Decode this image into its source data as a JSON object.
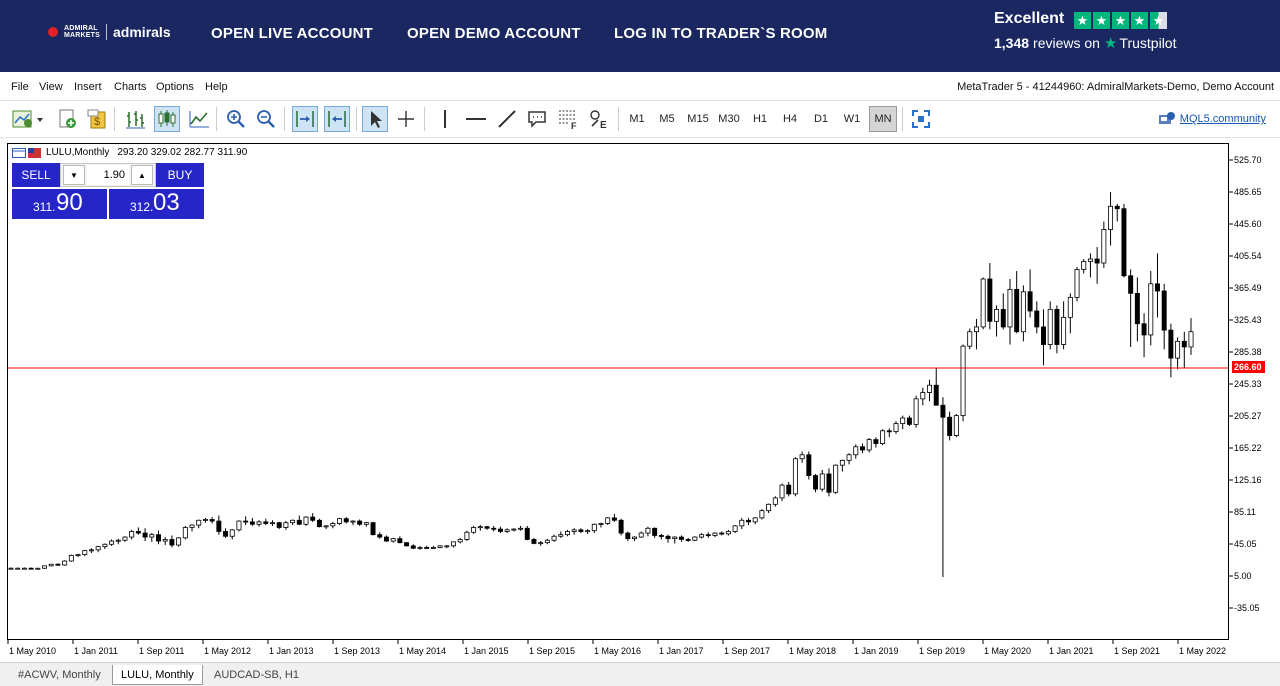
{
  "banner": {
    "logo_small_1": "ADMIRAL",
    "logo_small_2": "MARKETS",
    "logo_name": "admirals",
    "links": [
      "OPEN LIVE ACCOUNT",
      "OPEN DEMO ACCOUNT",
      "LOG IN TO TRADER`S ROOM"
    ],
    "trustpilot": {
      "rating_label": "Excellent",
      "review_count": "1,348",
      "reviews_word": "reviews on",
      "brand": "Trustpilot",
      "stars": 4.5
    }
  },
  "menu": {
    "items": [
      "File",
      "View",
      "Insert",
      "Charts",
      "Options",
      "Help"
    ],
    "window_title": "MetaTrader 5 - 41244960: AdmiralMarkets-Demo, Demo Account"
  },
  "toolbar": {
    "timeframes": [
      "M1",
      "M5",
      "M15",
      "M30",
      "H1",
      "H4",
      "D1",
      "W1",
      "MN"
    ],
    "active_timeframe": "MN",
    "community_link": "MQL5.community"
  },
  "chart": {
    "symbol_label": "LULU,Monthly",
    "ohlc_text": "293.20 329.02 282.77 311.90",
    "current_price_label": "266.60",
    "colors": {
      "price_line": "#ff0000",
      "candle": "#000000",
      "trade_blue": "#2626c8",
      "banner": "#1a2760"
    }
  },
  "trade_panel": {
    "sell_label": "SELL",
    "buy_label": "BUY",
    "lot": "1.90",
    "sell_price_small": "311.",
    "sell_price_big": "90",
    "buy_price_small": "312.",
    "buy_price_big": "03"
  },
  "chart_data": {
    "type": "candlestick",
    "title": "",
    "price_ticks": [
      "525.70",
      "485.65",
      "445.60",
      "405.54",
      "365.49",
      "325.43",
      "285.38",
      "245.33",
      "205.27",
      "165.22",
      "125.16",
      "85.11",
      "45.05",
      "5.00",
      "-35.05"
    ],
    "time_ticks": [
      "1 May 2010",
      "1 Jan 2011",
      "1 Sep 2011",
      "1 May 2012",
      "1 Jan 2013",
      "1 Sep 2013",
      "1 May 2014",
      "1 Jan 2015",
      "1 Sep 2015",
      "1 May 2016",
      "1 Jan 2017",
      "1 Sep 2017",
      "1 May 2018",
      "1 Jan 2019",
      "1 Sep 2019",
      "1 May 2020",
      "1 Jan 2021",
      "1 Sep 2021",
      "1 May 2022"
    ],
    "horizontal_line": 266.6,
    "ohlc": [
      [
        15,
        17,
        14,
        16
      ],
      [
        16,
        17,
        15,
        16
      ],
      [
        16,
        17,
        15,
        16
      ],
      [
        16,
        17,
        15,
        15
      ],
      [
        15,
        16,
        14,
        16
      ],
      [
        16,
        19,
        15,
        19
      ],
      [
        19,
        21,
        18,
        21
      ],
      [
        21,
        22,
        19,
        20
      ],
      [
        20,
        26,
        19,
        25
      ],
      [
        25,
        33,
        24,
        32
      ],
      [
        32,
        34,
        30,
        33
      ],
      [
        33,
        39,
        31,
        38
      ],
      [
        38,
        41,
        35,
        39
      ],
      [
        39,
        44,
        36,
        43
      ],
      [
        43,
        47,
        40,
        46
      ],
      [
        46,
        52,
        44,
        50
      ],
      [
        50,
        53,
        46,
        51
      ],
      [
        51,
        56,
        49,
        55
      ],
      [
        55,
        64,
        52,
        62
      ],
      [
        62,
        67,
        58,
        60
      ],
      [
        60,
        66,
        50,
        55
      ],
      [
        55,
        60,
        49,
        58
      ],
      [
        58,
        63,
        46,
        50
      ],
      [
        50,
        55,
        45,
        52
      ],
      [
        52,
        57,
        42,
        45
      ],
      [
        45,
        55,
        43,
        54
      ],
      [
        54,
        69,
        52,
        67
      ],
      [
        67,
        71,
        62,
        70
      ],
      [
        70,
        77,
        66,
        76
      ],
      [
        76,
        79,
        73,
        77
      ],
      [
        77,
        80,
        72,
        75
      ],
      [
        75,
        82,
        58,
        62
      ],
      [
        62,
        66,
        54,
        56
      ],
      [
        56,
        65,
        52,
        64
      ],
      [
        64,
        76,
        62,
        75
      ],
      [
        75,
        81,
        70,
        74
      ],
      [
        74,
        79,
        69,
        71
      ],
      [
        71,
        76,
        68,
        74
      ],
      [
        74,
        78,
        70,
        72
      ],
      [
        72,
        76,
        69,
        73
      ],
      [
        73,
        74,
        65,
        67
      ],
      [
        67,
        75,
        64,
        73
      ],
      [
        73,
        77,
        70,
        76
      ],
      [
        76,
        82,
        70,
        71
      ],
      [
        71,
        81,
        69,
        80
      ],
      [
        80,
        85,
        74,
        76
      ],
      [
        76,
        78,
        67,
        68
      ],
      [
        68,
        70,
        65,
        69
      ],
      [
        69,
        74,
        66,
        72
      ],
      [
        72,
        79,
        70,
        78
      ],
      [
        78,
        80,
        72,
        74
      ],
      [
        74,
        76,
        70,
        75
      ],
      [
        75,
        77,
        69,
        71
      ],
      [
        71,
        74,
        68,
        73
      ],
      [
        73,
        74,
        57,
        58
      ],
      [
        58,
        61,
        53,
        55
      ],
      [
        55,
        57,
        49,
        50
      ],
      [
        50,
        54,
        48,
        53
      ],
      [
        53,
        56,
        47,
        48
      ],
      [
        48,
        49,
        43,
        44
      ],
      [
        44,
        46,
        40,
        41
      ],
      [
        41,
        44,
        39,
        42
      ],
      [
        42,
        44,
        40,
        41
      ],
      [
        41,
        44,
        40,
        42
      ],
      [
        42,
        45,
        41,
        44
      ],
      [
        44,
        45,
        41,
        44
      ],
      [
        44,
        49,
        42,
        49
      ],
      [
        49,
        54,
        47,
        52
      ],
      [
        52,
        63,
        50,
        61
      ],
      [
        61,
        69,
        59,
        67
      ],
      [
        67,
        70,
        63,
        68
      ],
      [
        68,
        69,
        64,
        66
      ],
      [
        66,
        69,
        62,
        65
      ],
      [
        65,
        68,
        60,
        62
      ],
      [
        62,
        66,
        60,
        64
      ],
      [
        64,
        66,
        62,
        65
      ],
      [
        65,
        69,
        63,
        66
      ],
      [
        66,
        69,
        51,
        52
      ],
      [
        52,
        54,
        46,
        47
      ],
      [
        47,
        50,
        44,
        48
      ],
      [
        48,
        53,
        46,
        51
      ],
      [
        51,
        58,
        49,
        56
      ],
      [
        56,
        62,
        54,
        58
      ],
      [
        58,
        64,
        56,
        62
      ],
      [
        62,
        66,
        58,
        64
      ],
      [
        64,
        66,
        60,
        62
      ],
      [
        62,
        65,
        59,
        63
      ],
      [
        63,
        72,
        60,
        71
      ],
      [
        71,
        73,
        67,
        72
      ],
      [
        72,
        80,
        70,
        79
      ],
      [
        79,
        84,
        74,
        76
      ],
      [
        76,
        78,
        57,
        60
      ],
      [
        60,
        62,
        50,
        53
      ],
      [
        53,
        56,
        50,
        55
      ],
      [
        55,
        62,
        54,
        60
      ],
      [
        60,
        68,
        56,
        66
      ],
      [
        66,
        67,
        54,
        57
      ],
      [
        57,
        59,
        52,
        56
      ],
      [
        56,
        58,
        48,
        53
      ],
      [
        53,
        56,
        47,
        55
      ],
      [
        55,
        57,
        49,
        52
      ],
      [
        52,
        54,
        49,
        51
      ],
      [
        51,
        56,
        50,
        55
      ],
      [
        55,
        60,
        53,
        58
      ],
      [
        58,
        61,
        54,
        57
      ],
      [
        57,
        61,
        55,
        60
      ],
      [
        60,
        62,
        57,
        59
      ],
      [
        59,
        64,
        57,
        62
      ],
      [
        62,
        70,
        60,
        69
      ],
      [
        69,
        79,
        65,
        76
      ],
      [
        76,
        79,
        70,
        74
      ],
      [
        74,
        80,
        71,
        79
      ],
      [
        79,
        90,
        77,
        88
      ],
      [
        88,
        97,
        85,
        96
      ],
      [
        96,
        106,
        93,
        104
      ],
      [
        104,
        122,
        100,
        120
      ],
      [
        120,
        124,
        106,
        109
      ],
      [
        109,
        155,
        106,
        153
      ],
      [
        153,
        162,
        148,
        158
      ],
      [
        158,
        162,
        127,
        132
      ],
      [
        132,
        134,
        111,
        115
      ],
      [
        115,
        139,
        112,
        134
      ],
      [
        134,
        141,
        106,
        111
      ],
      [
        111,
        146,
        109,
        145
      ],
      [
        145,
        152,
        137,
        151
      ],
      [
        151,
        160,
        146,
        158
      ],
      [
        158,
        171,
        153,
        168
      ],
      [
        168,
        172,
        160,
        164
      ],
      [
        164,
        179,
        161,
        177
      ],
      [
        177,
        180,
        167,
        172
      ],
      [
        172,
        190,
        170,
        188
      ],
      [
        188,
        191,
        180,
        187
      ],
      [
        187,
        200,
        184,
        197
      ],
      [
        197,
        207,
        190,
        204
      ],
      [
        204,
        207,
        194,
        196
      ],
      [
        196,
        232,
        192,
        228
      ],
      [
        228,
        242,
        220,
        236
      ],
      [
        236,
        252,
        225,
        245
      ],
      [
        245,
        266,
        222,
        220
      ],
      [
        220,
        230,
        5,
        205
      ],
      [
        205,
        212,
        176,
        182
      ],
      [
        182,
        209,
        180,
        207
      ],
      [
        207,
        296,
        200,
        294
      ],
      [
        294,
        316,
        290,
        312
      ],
      [
        312,
        328,
        290,
        318
      ],
      [
        318,
        380,
        315,
        378
      ],
      [
        378,
        398,
        315,
        325
      ],
      [
        325,
        345,
        306,
        340
      ],
      [
        340,
        360,
        315,
        318
      ],
      [
        318,
        378,
        296,
        365
      ],
      [
        365,
        388,
        310,
        312
      ],
      [
        312,
        370,
        300,
        362
      ],
      [
        362,
        390,
        330,
        338
      ],
      [
        338,
        350,
        310,
        318
      ],
      [
        318,
        340,
        270,
        296
      ],
      [
        296,
        350,
        290,
        340
      ],
      [
        340,
        345,
        285,
        296
      ],
      [
        296,
        350,
        290,
        330
      ],
      [
        330,
        360,
        310,
        355
      ],
      [
        355,
        393,
        350,
        390
      ],
      [
        390,
        403,
        385,
        400
      ],
      [
        400,
        410,
        380,
        403
      ],
      [
        403,
        418,
        372,
        398
      ],
      [
        398,
        450,
        392,
        440
      ],
      [
        440,
        487,
        420,
        469
      ],
      [
        469,
        472,
        450,
        466
      ],
      [
        466,
        472,
        380,
        382
      ],
      [
        382,
        390,
        293,
        360
      ],
      [
        360,
        380,
        300,
        322
      ],
      [
        322,
        335,
        280,
        308
      ],
      [
        308,
        388,
        295,
        372
      ],
      [
        372,
        410,
        330,
        363
      ],
      [
        363,
        372,
        290,
        314
      ],
      [
        314,
        322,
        255,
        279
      ],
      [
        279,
        305,
        265,
        300
      ],
      [
        300,
        312,
        266,
        293
      ],
      [
        293,
        329,
        283,
        312
      ]
    ]
  },
  "tabs": [
    "#ACWV, Monthly",
    "LULU, Monthly",
    "AUDCAD-SB, H1"
  ],
  "active_tab": 1
}
